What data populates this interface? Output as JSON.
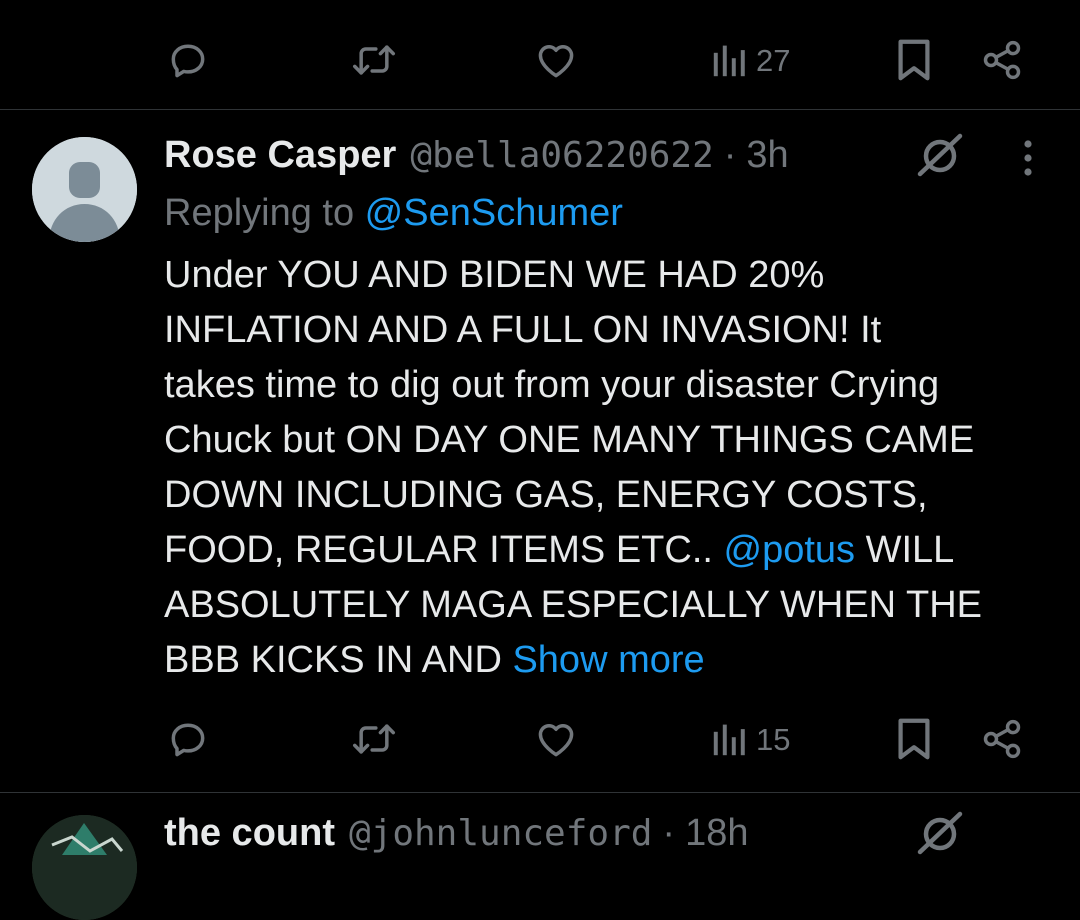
{
  "top_actions": {
    "views_count": "27"
  },
  "tweet": {
    "author_name": "Rose Casper",
    "author_handle": "@bella06220622",
    "separator": "·",
    "time": "3h",
    "replying_prefix": "Replying to ",
    "replying_to": "@SenSchumer",
    "text_lines": [
      "Under YOU AND BIDEN WE HAD 20%",
      "INFLATION AND A FULL ON INVASION! It",
      "takes time to dig out from your disaster Crying",
      "Chuck but ON DAY ONE MANY THINGS CAME",
      "DOWN INCLUDING GAS, ENERGY COSTS,",
      "FOOD, REGULAR ITEMS ETC.. ",
      "ABSOLUTELY MAGA ESPECIALLY WHEN THE",
      "BBB KICKS IN AND "
    ],
    "inline_mention": "@potus",
    "after_mention": " WILL",
    "show_more": "Show more",
    "views_count": "15"
  },
  "next_tweet": {
    "author_name": "the count",
    "author_handle": "@johnlunceford",
    "separator": "·",
    "time": "18h"
  },
  "colors": {
    "background": "#000000",
    "text_primary": "#e7e9ea",
    "text_secondary": "#71767b",
    "accent": "#1d9bf0",
    "divider": "#2f3336"
  },
  "icons": {
    "reply": "reply-icon",
    "retweet": "retweet-icon",
    "like": "heart-icon",
    "views": "views-bar-icon",
    "bookmark": "bookmark-icon",
    "share": "share-icon",
    "grok": "grok-icon",
    "more": "more-vertical-icon"
  }
}
